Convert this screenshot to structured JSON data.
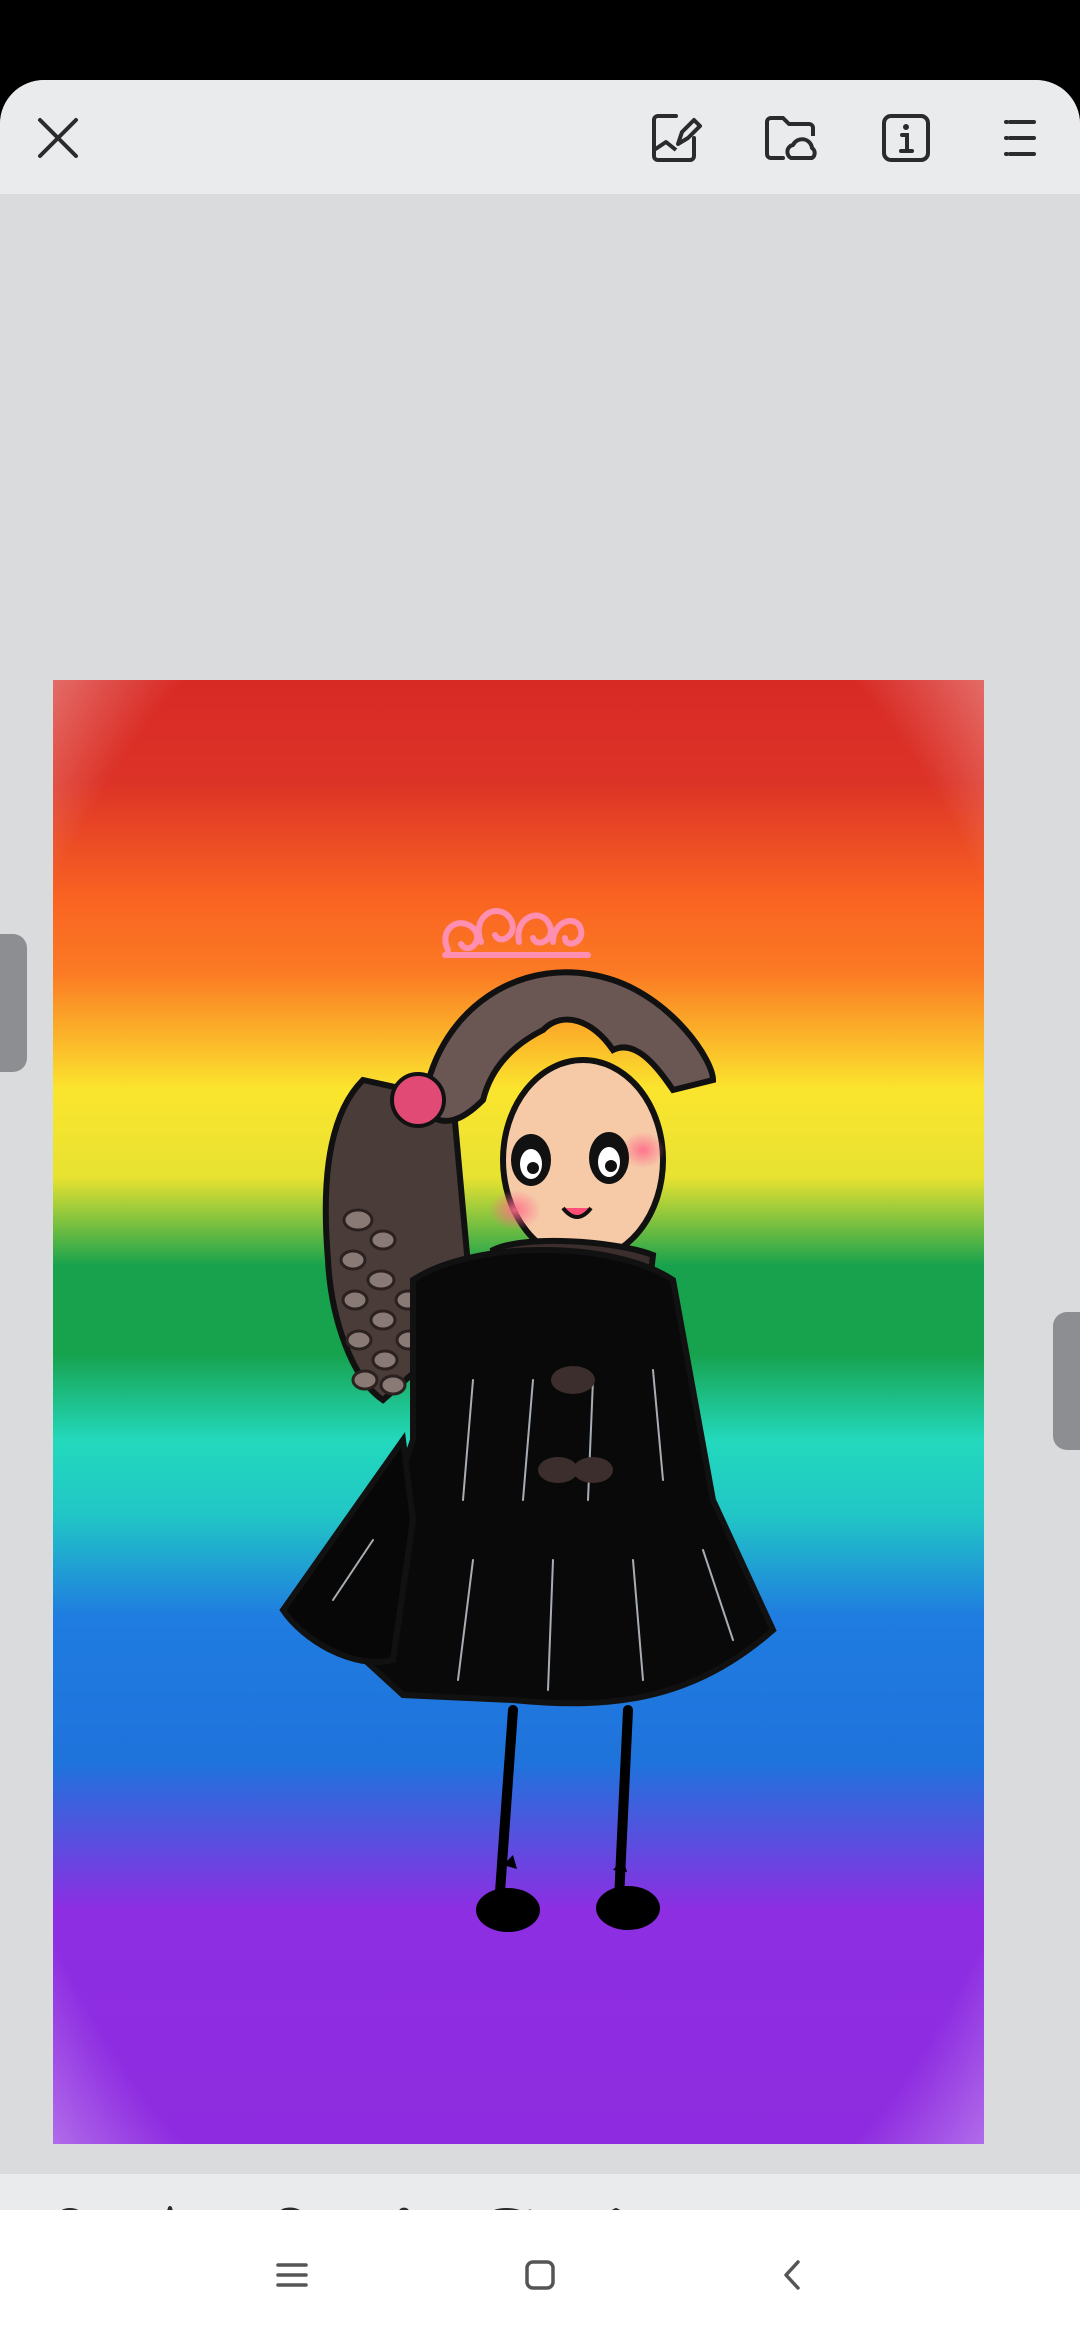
{
  "app": {
    "colors": {
      "toolbar_bg": "#eaebed",
      "workspace_bg": "#dadbdd",
      "icon": "#2b2b2e",
      "icon_disabled": "#b4b6ba",
      "handle": "#8c8e92"
    }
  },
  "topbar": {
    "icons": [
      "close-icon",
      "export-icon",
      "cloud-folder-icon",
      "info-icon",
      "menu-icon"
    ]
  },
  "canvas": {
    "artwork": "rainbow-girl-drawing",
    "stripe_colors": [
      "#dc3327",
      "#fa6422",
      "#fbe52e",
      "#18a24d",
      "#23d9bd",
      "#1f7ce0",
      "#8d2ee2"
    ]
  },
  "toolbar": {
    "tools": [
      "shape-icon",
      "pencil-icon",
      "fill-icon",
      "eraser-icon",
      "palette-icon",
      "layers-icon"
    ],
    "undo": "undo-icon",
    "redo": "redo-icon",
    "redo_enabled": false
  },
  "navbar": {
    "icons": [
      "recents-icon",
      "home-icon",
      "back-icon"
    ]
  }
}
